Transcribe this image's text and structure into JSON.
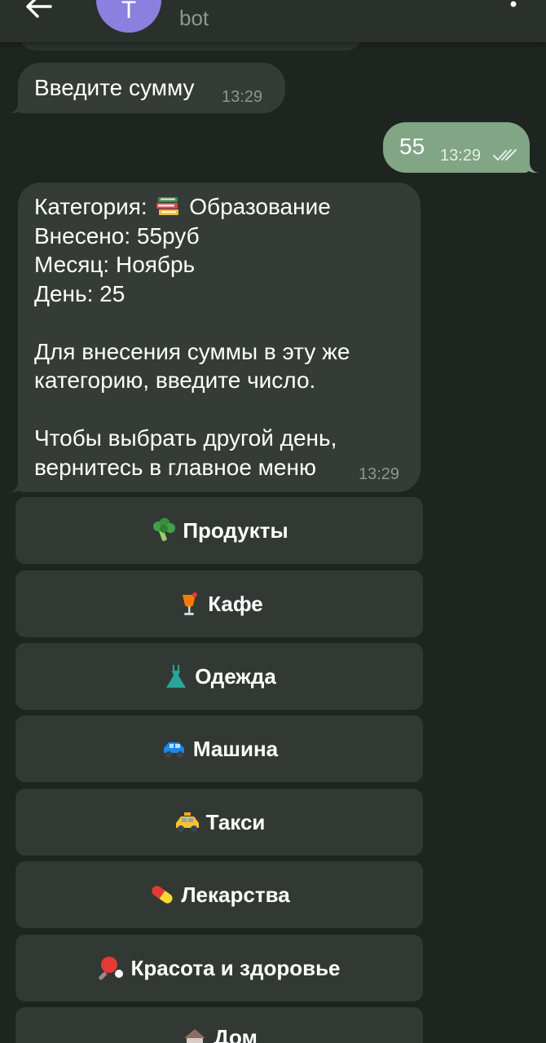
{
  "header": {
    "avatar_letter": "T",
    "subtitle": "bot"
  },
  "messages": {
    "enter_amount": {
      "text": "Введите сумму",
      "time": "13:29"
    },
    "user_amount": {
      "text": "55",
      "time": "13:29"
    },
    "summary": {
      "category_prefix": "Категория:",
      "category_name": "Образование",
      "category_icon": "books-icon",
      "lines": "Внесено: 55руб\nМесяц: Ноябрь\nДень: 25\n\nДля внесения суммы в эту же\nкатегорию, введите число.\n\nЧтобы выбрать другой день,\nвернитесь в главное меню",
      "time": "13:29"
    }
  },
  "keyboard": {
    "buttons": [
      {
        "label": "Продукты",
        "icon": "broccoli-icon"
      },
      {
        "label": "Кафе",
        "icon": "cocktail-icon"
      },
      {
        "label": "Одежда",
        "icon": "dress-icon"
      },
      {
        "label": "Машина",
        "icon": "car-icon"
      },
      {
        "label": "Такси",
        "icon": "taxi-icon"
      },
      {
        "label": "Лекарства",
        "icon": "pill-icon"
      },
      {
        "label": "Красота и здоровье",
        "icon": "ping-pong-icon"
      },
      {
        "label": "Дом",
        "icon": "house-icon"
      }
    ]
  },
  "colors": {
    "background": "#1e241f",
    "incoming_bubble": "#353b37",
    "outgoing_bubble": "#81a585",
    "keyboard_button": "#323834",
    "avatar": "#8b7fe0"
  }
}
